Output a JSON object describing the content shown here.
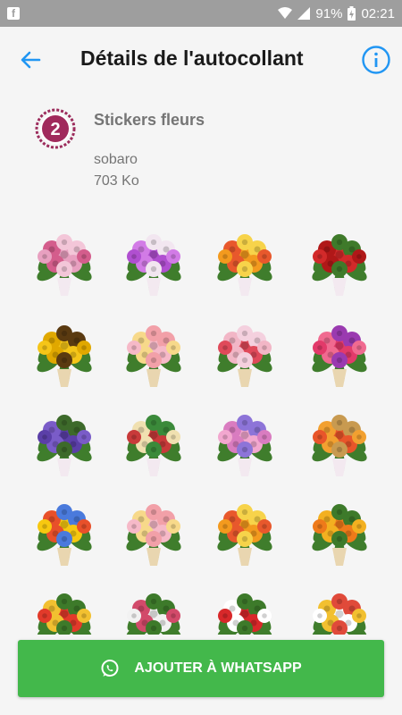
{
  "status": {
    "battery": "91%",
    "time": "02:21",
    "app_icon_letter": "f"
  },
  "header": {
    "title": "Détails de l'autocollant"
  },
  "pack": {
    "logo_number": "2",
    "name": "Stickers fleurs",
    "author": "sobaro",
    "size": "703 Ko"
  },
  "stickers": [
    "pink-roses-bouquet",
    "purple-flower-heart-envelope",
    "orange-lily-bouquet",
    "red-roses-basket",
    "sunflower-bouquet",
    "pastel-roses-bouquet",
    "pink-wrapped-bouquet",
    "gerbera-bouquet",
    "purple-iris-bouquet",
    "mixed-flower-bouquet",
    "pink-hydrangea-bouquet",
    "tulip-basket",
    "yellow-mixed-bouquet",
    "pastel-roses-bouquet",
    "orange-lily-bouquet",
    "orange-round-bouquet",
    "red-flower-arrangement",
    "white-flower-arrangement",
    "red-white-arrangement",
    "daisy-arrangement"
  ],
  "action": {
    "add_label": "AJOUTER À WHATSAPP"
  },
  "colors": {
    "accent": "#2196f3",
    "whatsapp_green": "#43b84b",
    "status_bar": "#9e9e9e"
  }
}
